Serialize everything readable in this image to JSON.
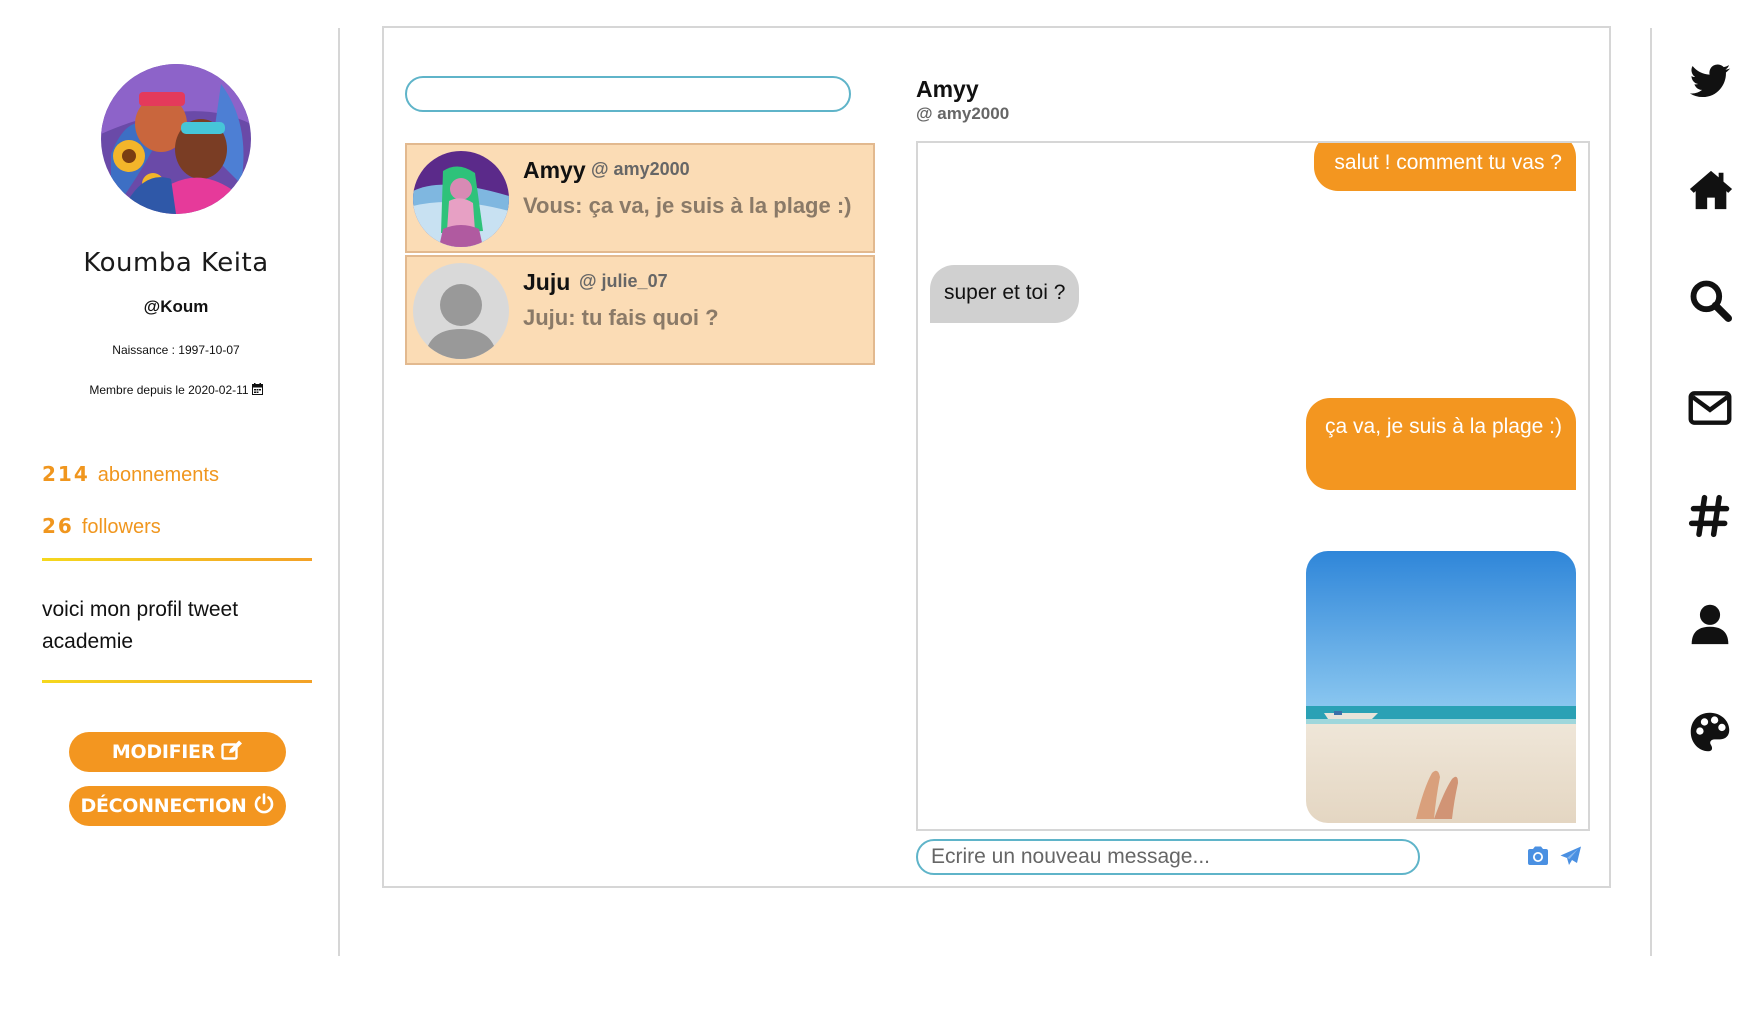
{
  "profile": {
    "name": "Koumba Keita",
    "handle": "@Koum",
    "birth": "Naissance : 1997-10-07",
    "member_since": "Membre depuis le 2020-02-11",
    "following_count": "214",
    "following_label": "abonnements",
    "followers_count": "26",
    "followers_label": "followers",
    "bio": "voici mon profil tweet academie",
    "edit_label": "MODIFIER",
    "logout_label": "DÉCONNECTION",
    "accent_color": "#f39620"
  },
  "conversations": [
    {
      "name": "Amyy",
      "handle": "@ amy2000",
      "preview": "Vous: ça va, je suis à la plage :)"
    },
    {
      "name": "Juju",
      "handle": "@ julie_07",
      "preview": "Juju: tu fais quoi ?"
    }
  ],
  "chat": {
    "name": "Amyy",
    "handle": "@ amy2000",
    "messages": [
      {
        "from": "me",
        "text": "salut ! comment tu vas ?"
      },
      {
        "from": "them",
        "text": "super et toi ?"
      },
      {
        "from": "me",
        "text": "ça va, je suis à la plage :)"
      },
      {
        "from": "me",
        "type": "image",
        "content": "beach-photo"
      }
    ],
    "compose_placeholder": "Ecrire un nouveau message...",
    "icons": [
      "camera-icon",
      "send-icon"
    ]
  },
  "nav": {
    "icons": [
      "twitter-icon",
      "home-icon",
      "search-icon",
      "mail-icon",
      "hashtag-icon",
      "user-icon",
      "palette-icon"
    ]
  }
}
